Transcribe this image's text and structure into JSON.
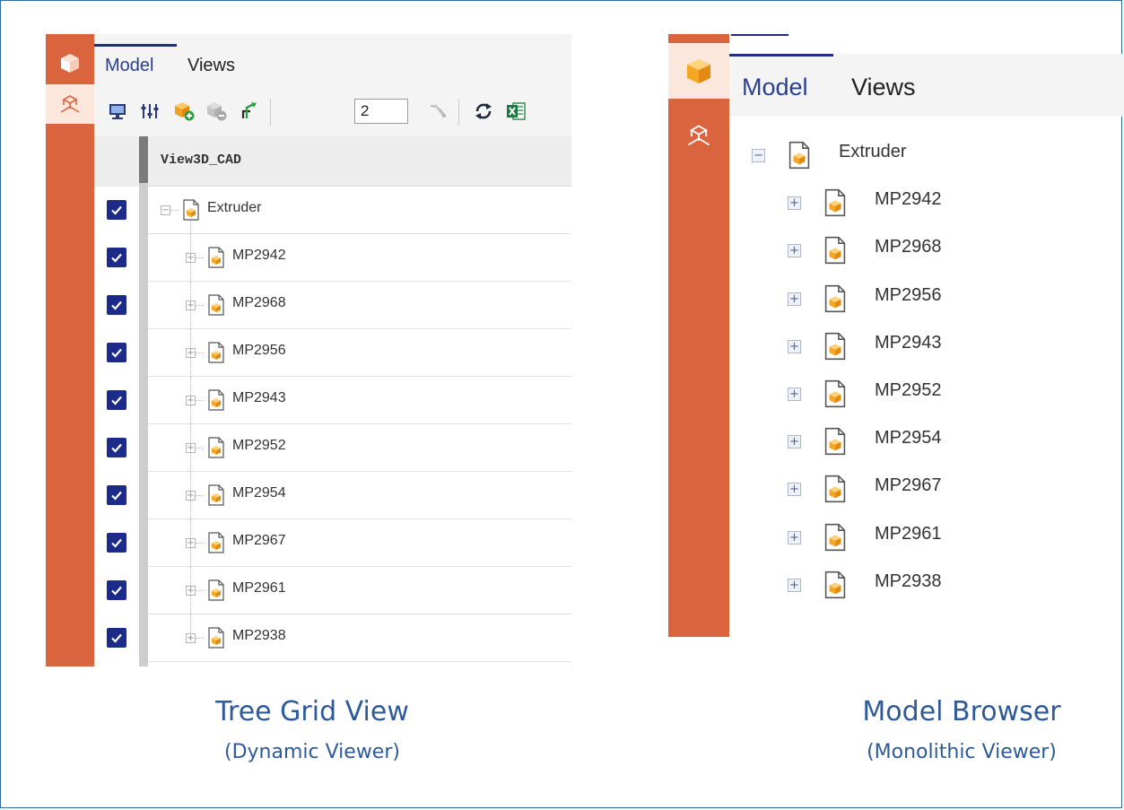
{
  "tree_grid": {
    "tabs": [
      "Model",
      "Views"
    ],
    "toolbar": {
      "level_value": "2"
    },
    "column_header": "View3D_CAD",
    "root": {
      "label": "Extruder",
      "checked": true
    },
    "children": [
      {
        "label": "MP2942",
        "checked": true
      },
      {
        "label": "MP2968",
        "checked": true
      },
      {
        "label": "MP2956",
        "checked": true
      },
      {
        "label": "MP2943",
        "checked": true
      },
      {
        "label": "MP2952",
        "checked": true
      },
      {
        "label": "MP2954",
        "checked": true
      },
      {
        "label": "MP2967",
        "checked": true
      },
      {
        "label": "MP2961",
        "checked": true
      },
      {
        "label": "MP2938",
        "checked": true
      }
    ],
    "caption_title": "Tree Grid View",
    "caption_sub": "(Dynamic Viewer)"
  },
  "model_browser": {
    "tabs": [
      "Model",
      "Views"
    ],
    "root": {
      "label": "Extruder"
    },
    "children": [
      {
        "label": "MP2942"
      },
      {
        "label": "MP2968"
      },
      {
        "label": "MP2956"
      },
      {
        "label": "MP2943"
      },
      {
        "label": "MP2952"
      },
      {
        "label": "MP2954"
      },
      {
        "label": "MP2967"
      },
      {
        "label": "MP2961"
      },
      {
        "label": "MP2938"
      }
    ],
    "caption_title": "Model Browser",
    "caption_sub": "(Monolithic Viewer)"
  },
  "colors": {
    "rail": "#d9643e",
    "rail_active": "#fbe7dc",
    "accent": "#1f2f7e",
    "checkbox": "#1c2a8a",
    "caption": "#2e5a9a",
    "part_icon": "#f5a623"
  },
  "icons": {
    "rail": [
      "cube-icon",
      "assembly-structure-icon"
    ],
    "toolbar": [
      "display-icon",
      "filter-settings-icon",
      "add-part-icon",
      "remove-part-icon",
      "expand-tree-icon",
      "collapse-level-icon",
      "refresh-icon",
      "excel-export-icon"
    ]
  }
}
